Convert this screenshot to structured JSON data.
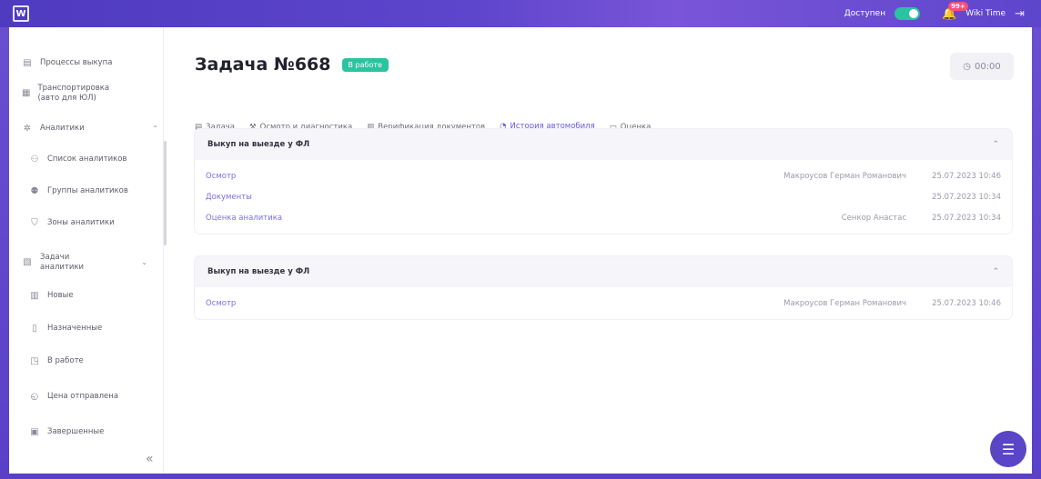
{
  "colors": {
    "brand": "#5a44c8",
    "accent": "#2bc3a0",
    "link": "#7b6ee6",
    "badge": "#ff4d79"
  },
  "topbar": {
    "logo_text": "W",
    "availability_label": "Доступен",
    "availability_on": true,
    "notifications_count": "99+",
    "user_name": "Wiki Time"
  },
  "sidebar": {
    "items": [
      {
        "label": "Процессы выкупа",
        "icon": "list-icon"
      },
      {
        "label": "Транспортировка (авто для ЮЛ)",
        "icon": "truck-icon"
      },
      {
        "label": "Аналитики",
        "icon": "analytics-icon",
        "expandable": true
      },
      {
        "label": "Список аналитиков",
        "icon": "users-icon"
      },
      {
        "label": "Группы аналитиков",
        "icon": "group-icon"
      },
      {
        "label": "Зоны аналитики",
        "icon": "zone-icon"
      },
      {
        "label": "Задачи аналитики",
        "icon": "tasks-icon",
        "expandable": true
      },
      {
        "label": "Новые",
        "icon": "new-icon"
      },
      {
        "label": "Назначенные",
        "icon": "assigned-icon"
      },
      {
        "label": "В работе",
        "icon": "inwork-icon"
      },
      {
        "label": "Цена отправлена",
        "icon": "price-icon"
      },
      {
        "label": "Завершенные",
        "icon": "done-icon"
      }
    ],
    "collapse_label": "«"
  },
  "page": {
    "title": "Задача №668",
    "status": "В работе",
    "timer": "00:00"
  },
  "tabs": [
    {
      "label": "Задача",
      "active": false
    },
    {
      "label": "Осмотр и диагностика",
      "active": false
    },
    {
      "label": "Верификация документов",
      "active": false
    },
    {
      "label": "История автомобиля",
      "active": true
    },
    {
      "label": "Оценка",
      "active": false
    }
  ],
  "history": [
    {
      "title": "Выкуп на выезде у ФЛ",
      "rows": [
        {
          "name": "Осмотр",
          "person": "Макроусов Герман Романович",
          "date": "25.07.2023 10:46"
        },
        {
          "name": "Документы",
          "person": "",
          "date": "25.07.2023 10:34"
        },
        {
          "name": "Оценка аналитика",
          "person": "Сенкор Анастас",
          "date": "25.07.2023 10:34"
        }
      ]
    },
    {
      "title": "Выкуп на выезде у ФЛ",
      "rows": [
        {
          "name": "Осмотр",
          "person": "Макроусов Герман Романович",
          "date": "25.07.2023 10:46"
        }
      ]
    }
  ]
}
